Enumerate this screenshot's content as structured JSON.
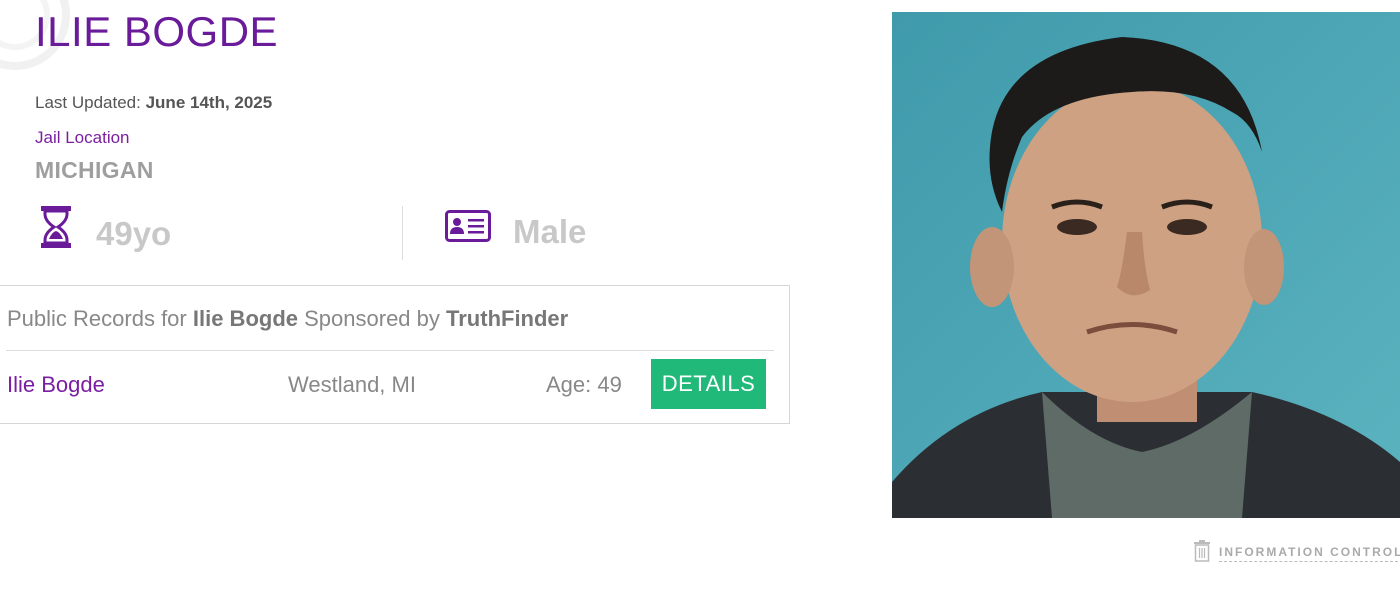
{
  "profile": {
    "name": "ILIE BOGDE",
    "last_updated_label": "Last Updated:",
    "last_updated_value": "June 14th, 2025",
    "jail_location_label": "Jail Location",
    "jail_location_value": "MICHIGAN",
    "age": "49yo",
    "sex": "Male"
  },
  "records": {
    "title_prefix": "Public Records for",
    "title_name": "Ilie Bogde",
    "title_middle": "Sponsored by",
    "title_sponsor": "TruthFinder",
    "row": {
      "name": "Ilie Bogde",
      "location": "Westland, MI",
      "age": "Age: 49",
      "details_label": "DETAILS"
    }
  },
  "footer": {
    "info_control_label": "INFORMATION CONTROL"
  },
  "colors": {
    "accent_purple": "#6a1b9a",
    "button_green": "#20b97a",
    "photo_bg": "#4aa3b2"
  },
  "icons": {
    "age": "hourglass-icon",
    "sex": "id-card-icon",
    "info_control": "trash-icon"
  }
}
